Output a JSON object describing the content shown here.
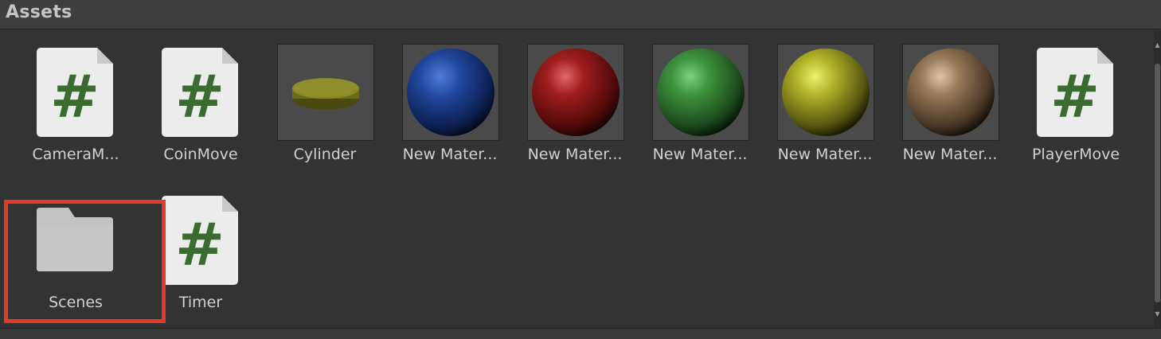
{
  "panel": {
    "title": "Assets"
  },
  "colors": {
    "highlight": "#e33b27",
    "script_hash": "#3a6b2f"
  },
  "assets": [
    {
      "label": "CameraM...",
      "icon": "csharp-script-icon"
    },
    {
      "label": "CoinMove",
      "icon": "csharp-script-icon"
    },
    {
      "label": "Cylinder",
      "icon": "cylinder-mesh-icon"
    },
    {
      "label": "New Mater...",
      "icon": "blue-material-sphere-icon"
    },
    {
      "label": "New Mater...",
      "icon": "red-material-sphere-icon"
    },
    {
      "label": "New Mater...",
      "icon": "green-material-sphere-icon"
    },
    {
      "label": "New Mater...",
      "icon": "yellow-material-sphere-icon"
    },
    {
      "label": "New Mater...",
      "icon": "brown-material-sphere-icon"
    },
    {
      "label": "PlayerMove",
      "icon": "csharp-script-icon"
    },
    {
      "label": "Scenes",
      "icon": "folder-icon",
      "highlighted": true
    },
    {
      "label": "Timer",
      "icon": "csharp-script-icon"
    }
  ]
}
